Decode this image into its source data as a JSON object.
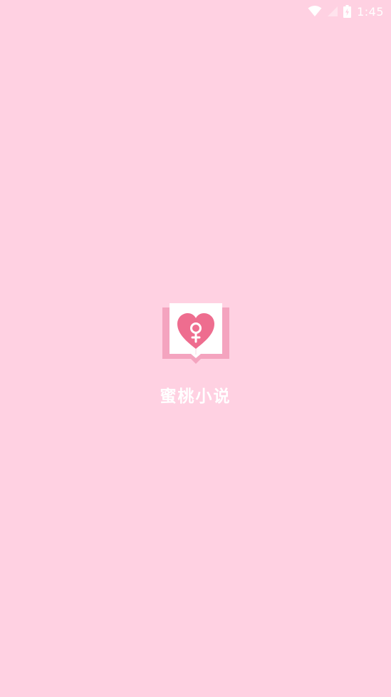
{
  "colors": {
    "background": "#ffd1e2",
    "status_icon": "#ffffff",
    "book_cover": "#f4a4bf",
    "book_pages": "#ffffff",
    "heart": "#ee6d8f",
    "symbol": "#ffffff",
    "app_name_text": "#ffffff"
  },
  "status_bar": {
    "time": "1:45",
    "icons": [
      "wifi-icon",
      "signal-icon",
      "battery-charging-icon"
    ]
  },
  "splash": {
    "logo_icon": "book-heart-female-icon",
    "app_name": "蜜桃小说"
  }
}
